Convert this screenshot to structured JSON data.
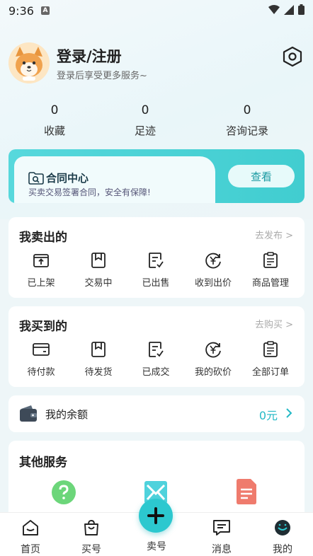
{
  "status_bar": {
    "time": "9:36",
    "notification_badge": "A"
  },
  "profile": {
    "title": "登录/注册",
    "subtitle": "登录后享受更多服务~"
  },
  "stats": [
    {
      "count": "0",
      "label": "收藏"
    },
    {
      "count": "0",
      "label": "足迹"
    },
    {
      "count": "0",
      "label": "咨询记录"
    }
  ],
  "contract": {
    "title": "合同中心",
    "subtitle": "买卖交易签署合同，安全有保障!",
    "button": "查看"
  },
  "sold": {
    "title": "我卖出的",
    "link": "去发布 >",
    "items": [
      {
        "label": "已上架",
        "icon": "box-up-icon"
      },
      {
        "label": "交易中",
        "icon": "bookmark-icon"
      },
      {
        "label": "已出售",
        "icon": "list-check-icon"
      },
      {
        "label": "收到出价",
        "icon": "yen-cycle-icon"
      },
      {
        "label": "商品管理",
        "icon": "clipboard-icon"
      }
    ]
  },
  "bought": {
    "title": "我买到的",
    "link": "去购买 >",
    "items": [
      {
        "label": "待付款",
        "icon": "card-icon"
      },
      {
        "label": "待发货",
        "icon": "bookmark-icon"
      },
      {
        "label": "已成交",
        "icon": "list-check-icon"
      },
      {
        "label": "我的砍价",
        "icon": "yen-cycle-icon"
      },
      {
        "label": "全部订单",
        "icon": "clipboard-icon"
      }
    ]
  },
  "balance": {
    "label": "我的余额",
    "value": "0元"
  },
  "other": {
    "title": "其他服务"
  },
  "tabbar": {
    "tabs": [
      {
        "label": "首页",
        "icon": "home-icon"
      },
      {
        "label": "买号",
        "icon": "bag-icon"
      },
      {
        "label": "卖号",
        "icon": "plus-icon"
      },
      {
        "label": "消息",
        "icon": "message-icon"
      },
      {
        "label": "我的",
        "icon": "profile-icon"
      }
    ]
  },
  "colors": {
    "accent": "#2cc8cf",
    "balance_value": "#24b9c6",
    "green_service": "#6cd67a",
    "cyan_service": "#4fd2dc",
    "red_service": "#ef7b6d"
  }
}
